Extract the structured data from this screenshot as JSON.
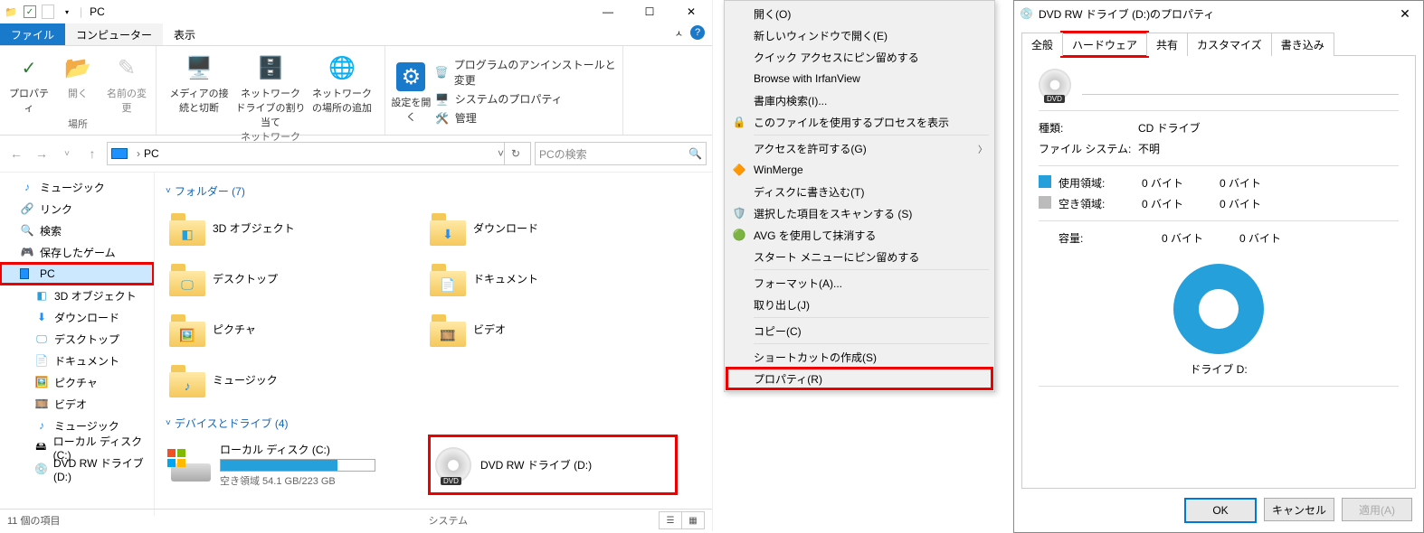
{
  "explorer": {
    "title": "PC",
    "tabs": {
      "file": "ファイル",
      "computer": "コンピューター",
      "view": "表示"
    },
    "ribbon": {
      "group_place": "場所",
      "group_network": "ネットワーク",
      "group_system": "システム",
      "btn_properties": "プロパティ",
      "btn_open": "開く",
      "btn_rename": "名前の変更",
      "btn_media": "メディアの接続と切断",
      "btn_mapdrive": "ネットワーク ドライブの割り当て",
      "btn_addloc": "ネットワークの場所の追加",
      "btn_settings": "設定を開く",
      "sys_uninstall": "プログラムのアンインストールと変更",
      "sys_sysprop": "システムのプロパティ",
      "sys_manage": "管理"
    },
    "address": {
      "location": "PC",
      "search_placeholder": "PCの検索"
    },
    "tree": {
      "music": "ミュージック",
      "link": "リンク",
      "search": "検索",
      "savedgames": "保存したゲーム",
      "pc": "PC",
      "objects3d": "3D オブジェクト",
      "downloads": "ダウンロード",
      "desktop": "デスクトップ",
      "documents": "ドキュメント",
      "pictures": "ピクチャ",
      "video": "ビデオ",
      "music2": "ミュージック",
      "localdisk": "ローカル ディスク (C:)",
      "dvddrive": "DVD RW ドライブ (D:)"
    },
    "groups": {
      "folders_header": "フォルダー (7)",
      "devices_header": "デバイスとドライブ (4)"
    },
    "folders": {
      "objects3d": "3D オブジェクト",
      "downloads": "ダウンロード",
      "desktop": "デスクトップ",
      "documents": "ドキュメント",
      "pictures": "ピクチャ",
      "video": "ビデオ",
      "music": "ミュージック"
    },
    "drives": {
      "localdisk_name": "ローカル ディスク (C:)",
      "localdisk_free": "空き領域 54.1 GB/223 GB",
      "dvd_name": "DVD RW ドライブ (D:)"
    },
    "status": "11 個の項目"
  },
  "ctx": {
    "open": "開く(O)",
    "newwindow": "新しいウィンドウで開く(E)",
    "pinquick": "クイック アクセスにピン留めする",
    "irfan": "Browse with IrfanView",
    "vault": "書庫内検索(I)...",
    "procs": "このファイルを使用するプロセスを表示",
    "grantaccess": "アクセスを許可する(G)",
    "winmerge": "WinMerge",
    "burn": "ディスクに書き込む(T)",
    "scan": "選択した項目をスキャンする (S)",
    "avg": "AVG を使用して抹消する",
    "pinstart": "スタート メニューにピン留めする",
    "format": "フォーマット(A)...",
    "eject": "取り出し(J)",
    "copy": "コピー(C)",
    "shortcut": "ショートカットの作成(S)",
    "properties": "プロパティ(R)"
  },
  "prop": {
    "title": "DVD RW ドライブ (D:)のプロパティ",
    "tabs": {
      "general": "全般",
      "hardware": "ハードウェア",
      "sharing": "共有",
      "customize": "カスタマイズ",
      "recording": "書き込み"
    },
    "kind_label": "種類:",
    "kind_value": "CD ドライブ",
    "fs_label": "ファイル システム:",
    "fs_value": "不明",
    "used_label": "使用領域:",
    "free_label": "空き領域:",
    "cap_label": "容量:",
    "bytes0a": "0 バイト",
    "bytes0b": "0 バイト",
    "drive_label": "ドライブ D:",
    "btn_ok": "OK",
    "btn_cancel": "キャンセル",
    "btn_apply": "適用(A)"
  }
}
